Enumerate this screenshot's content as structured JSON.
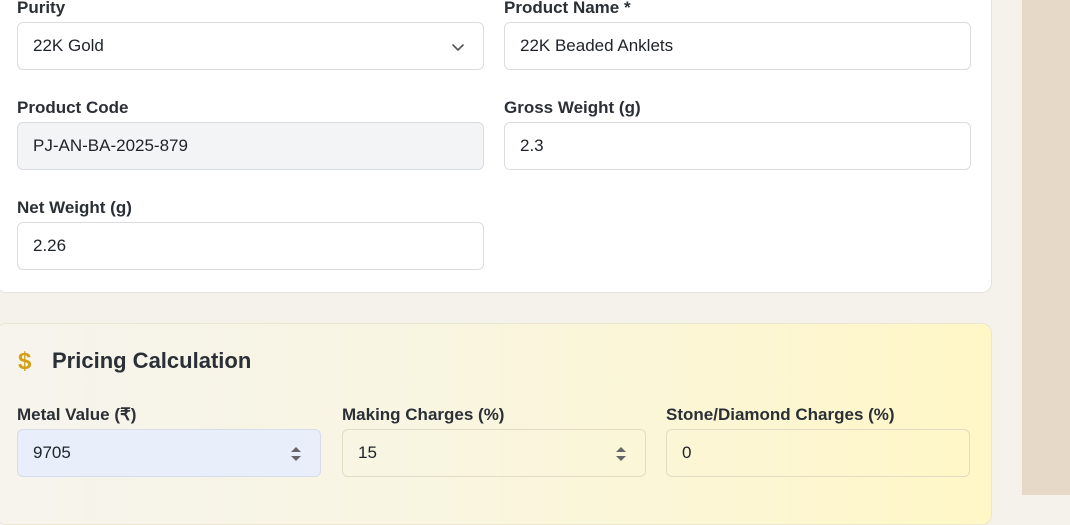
{
  "product_form": {
    "purity": {
      "label": "Purity",
      "value": "22K Gold"
    },
    "product_name": {
      "label": "Product Name *",
      "value": "22K Beaded Anklets"
    },
    "product_code": {
      "label": "Product Code",
      "value": "PJ-AN-BA-2025-879"
    },
    "gross_weight": {
      "label": "Gross Weight (g)",
      "value": "2.3"
    },
    "net_weight": {
      "label": "Net Weight (g)",
      "value": "2.26"
    }
  },
  "pricing": {
    "title": "Pricing Calculation",
    "icon": "dollar-icon",
    "icon_symbol": "$",
    "metal_value": {
      "label": "Metal Value (₹)",
      "value": "9705"
    },
    "making_charges": {
      "label": "Making Charges (%)",
      "value": "15"
    },
    "stone_charges": {
      "label": "Stone/Diamond Charges (%)",
      "value": "0"
    }
  },
  "colors": {
    "accent": "#d4a017",
    "page_bg": "#f5f2ec"
  }
}
